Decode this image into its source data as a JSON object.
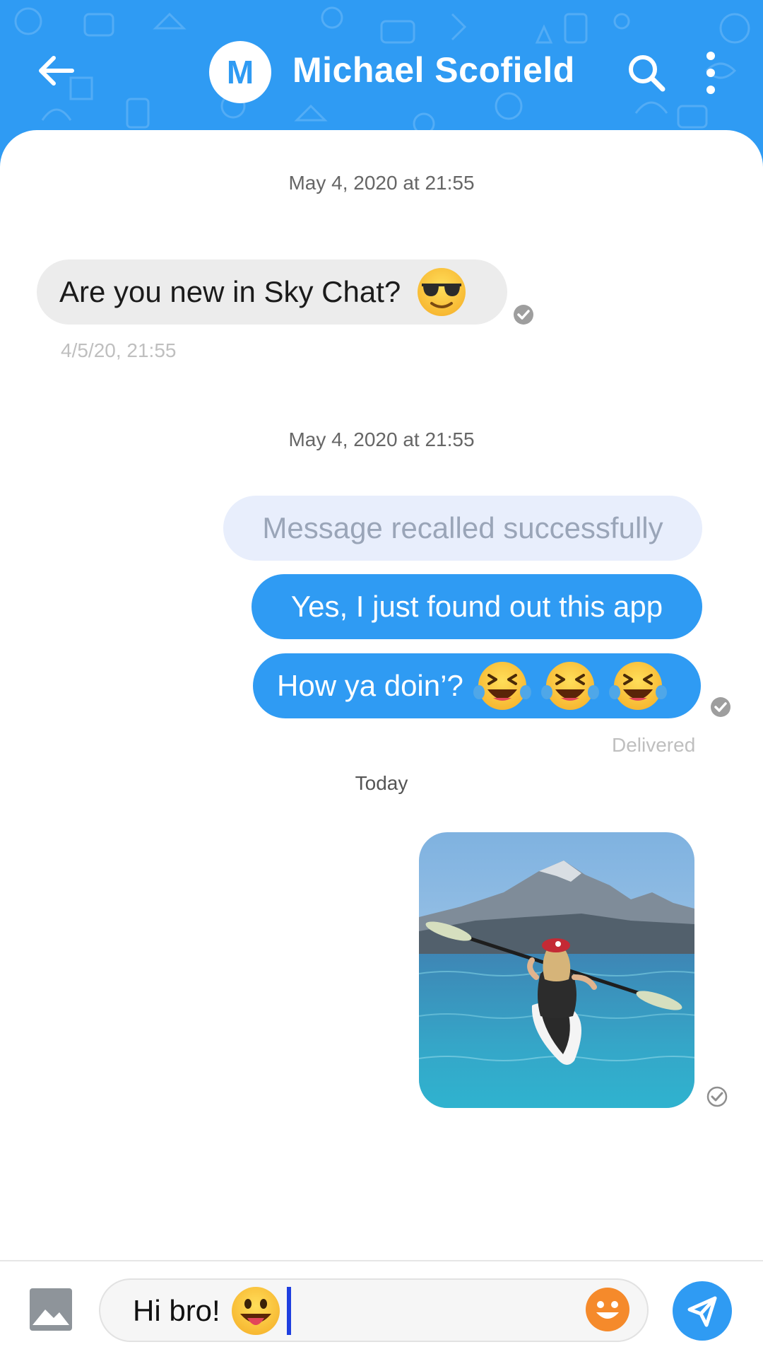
{
  "header": {
    "avatar_letter": "M",
    "contact_name": "Michael Scofield"
  },
  "chat": {
    "date_separator_1": "May 4, 2020 at 21:55",
    "incoming_message": {
      "text": "Are you new in Sky Chat?",
      "emoji": "smiling-face-with-sunglasses",
      "time": "4/5/20, 21:55"
    },
    "date_separator_2": "May 4, 2020 at 21:55",
    "recalled_message": "Message recalled successfully",
    "outgoing_message_1": "Yes, I just found out this app",
    "outgoing_message_2": {
      "text": "How ya doin’?",
      "emojis": [
        "laughing-with-tears",
        "laughing-with-tears",
        "laughing-with-tears"
      ]
    },
    "delivery_status": "Delivered",
    "date_separator_3": "Today",
    "photo_message": "photo of a person kayaking on a mountain lake"
  },
  "composer": {
    "input_value": "Hi bro!",
    "input_emoji": "grinning-face-with-tongue"
  },
  "colors": {
    "accent": "#2f9bf3",
    "incoming_bubble": "#ececec",
    "recalled_bubble": "#e8eefc",
    "caret": "#1f3fe0",
    "emoji_button": "#f58a2b"
  }
}
